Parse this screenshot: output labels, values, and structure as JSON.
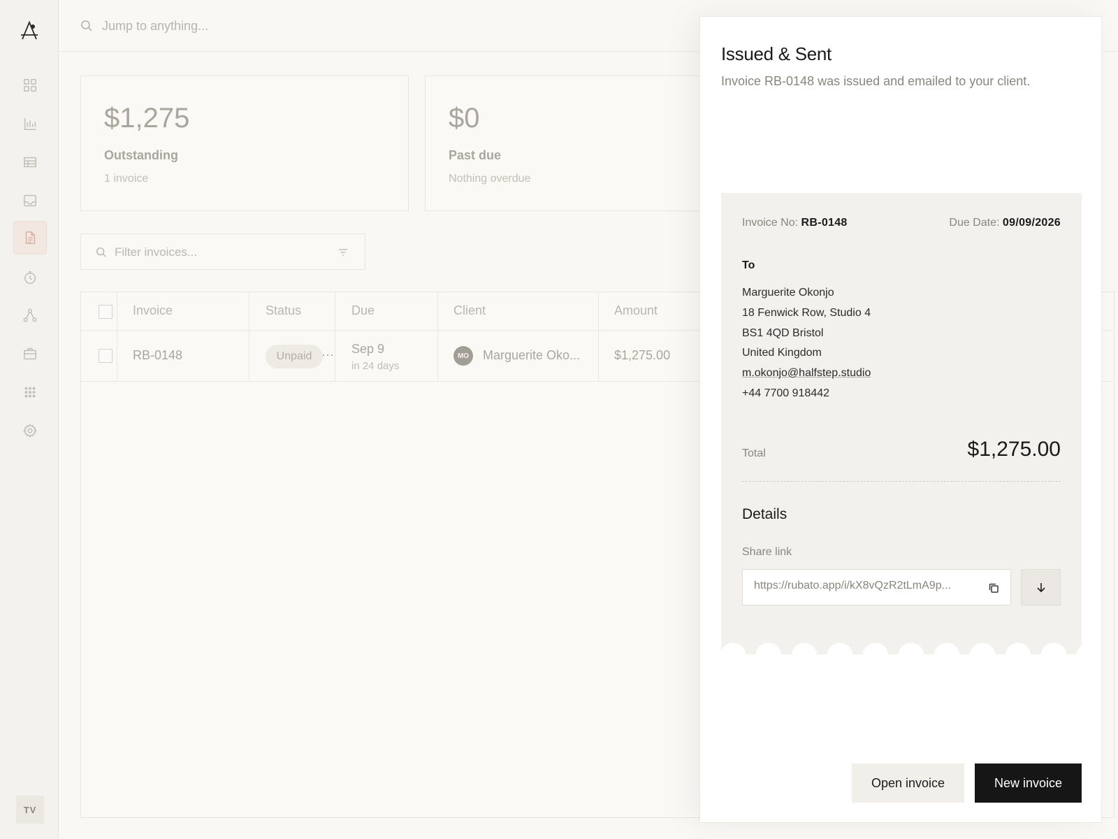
{
  "search": {
    "placeholder": "Jump to anything..."
  },
  "sidebar": {
    "items": [
      {
        "name": "dashboard",
        "icon": "grid-icon"
      },
      {
        "name": "reports",
        "icon": "bar-chart-icon"
      },
      {
        "name": "tables",
        "icon": "table-icon"
      },
      {
        "name": "inbox",
        "icon": "inbox-icon"
      },
      {
        "name": "invoices",
        "icon": "document-icon",
        "active": true
      },
      {
        "name": "time",
        "icon": "clock-icon"
      },
      {
        "name": "workflows",
        "icon": "nodes-icon"
      },
      {
        "name": "projects",
        "icon": "briefcase-icon"
      },
      {
        "name": "apps",
        "icon": "dots-grid-icon"
      },
      {
        "name": "settings",
        "icon": "gear-icon"
      }
    ],
    "user_initials": "TV"
  },
  "stats": [
    {
      "value": "$1,275",
      "label": "Outstanding",
      "sub": "1 invoice"
    },
    {
      "value": "$0",
      "label": "Past due",
      "sub": "Nothing overdue"
    }
  ],
  "filter": {
    "placeholder": "Filter invoices..."
  },
  "table": {
    "headers": {
      "invoice": "Invoice",
      "status": "Status",
      "due": "Due",
      "client": "Client",
      "amount": "Amount"
    },
    "rows": [
      {
        "invoice": "RB-0148",
        "status": "Unpaid",
        "more": "···",
        "due": "Sep 9",
        "due_sub": "in 24 days",
        "client_initials": "MO",
        "client": "Marguerite Oko...",
        "amount": "$1,275.00"
      }
    ]
  },
  "panel": {
    "title": "Issued & Sent",
    "description": "Invoice RB-0148 was issued and emailed to your client.",
    "invoice_no_label": "Invoice No:",
    "invoice_no": "RB-0148",
    "due_date_label": "Due Date:",
    "due_date": "09/09/2026",
    "to_label": "To",
    "address": {
      "name": "Marguerite Okonjo",
      "line1": "18 Fenwick Row, Studio 4",
      "line2": "BS1 4QD Bristol",
      "country": "United Kingdom",
      "email": "m.okonjo@halfstep.studio",
      "phone": "+44 7700 918442"
    },
    "total_label": "Total",
    "total": "$1,275.00",
    "details_title": "Details",
    "share_label": "Share link",
    "share_link": "https://rubato.app/i/kX8vQzR2tLmA9p...",
    "open_button": "Open invoice",
    "new_button": "New invoice"
  },
  "colors": {
    "accent": "#161616",
    "active_nav": "#f2e7e1",
    "receipt_bg": "#f3f1ed"
  }
}
